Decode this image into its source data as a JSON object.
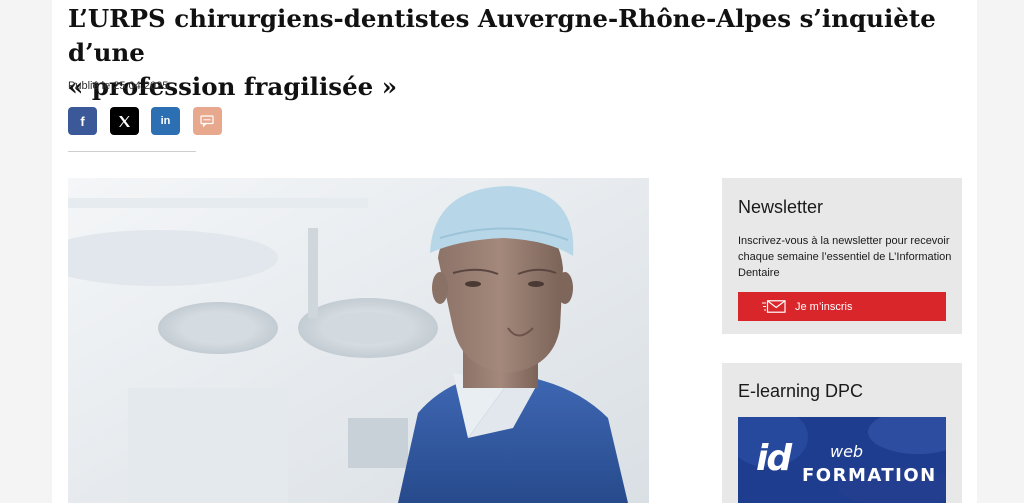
{
  "article": {
    "title_line1": "L’URPS chirurgiens-dentistes Auvergne-Rhône-Alpes s’inquiète d’une",
    "title_line2": "« profession fragilisée »",
    "published": "Publié le 25.04.2025."
  },
  "share": {
    "buttons": [
      {
        "label": "f",
        "icon": "facebook-icon",
        "color": "#3b5998"
      },
      {
        "label": "X",
        "icon": "x-icon",
        "color": "#000000"
      },
      {
        "label": "in",
        "icon": "linkedin-icon",
        "color": "#2c6fb3"
      },
      {
        "label": "",
        "icon": "comment-icon",
        "color": "#e8a88d"
      }
    ]
  },
  "sidebar": {
    "newsletter": {
      "title": "Newsletter",
      "text": "Inscrivez-vous à la newsletter pour recevoir chaque semaine l’essentiel de L’Information Dentaire",
      "button_label": "Je m’inscris",
      "button_color": "#d9262b"
    },
    "elearning": {
      "title": "E-learning DPC",
      "banner_id": "id",
      "banner_web": "web",
      "banner_formation": "FORMATION"
    }
  },
  "colors": {
    "page_background": "#f4f4f4",
    "sidebar_background": "#e8e8e8",
    "banner_blue": "#1f3d8f"
  }
}
